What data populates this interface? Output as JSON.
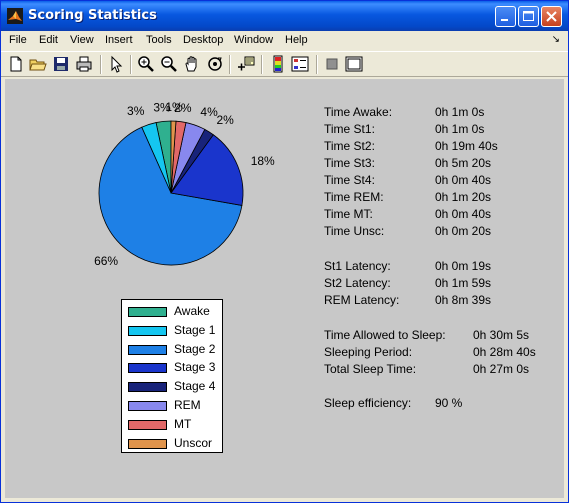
{
  "window": {
    "title": "Scoring Statistics"
  },
  "menu": [
    "File",
    "Edit",
    "View",
    "Insert",
    "Tools",
    "Desktop",
    "Window",
    "Help"
  ],
  "menu_arrow": "↘",
  "toolbar": {
    "icons": [
      "new-file-icon",
      "open-folder-icon",
      "save-icon",
      "print-icon",
      "pointer-arrow-icon",
      "zoom-in-icon",
      "zoom-out-icon",
      "pan-hand-icon",
      "rotate-3d-icon",
      "data-cursor-icon",
      "colorbar-icon",
      "legend-icon",
      "hide-plot-tools-icon",
      "show-plot-tools-icon"
    ]
  },
  "chart_data": {
    "type": "pie",
    "slices": [
      {
        "name": "Awake",
        "value": 1.0,
        "label": "3%",
        "color": "#2fb08f"
      },
      {
        "name": "Stage 1",
        "value": 1.0,
        "label": "3%",
        "color": "#15c6f0"
      },
      {
        "name": "Stage 2",
        "value": 19.67,
        "label": "66%",
        "color": "#1e80e6"
      },
      {
        "name": "Stage 3",
        "value": 5.33,
        "label": "18%",
        "color": "#1a35cc"
      },
      {
        "name": "Stage 4",
        "value": 0.67,
        "label": "2%",
        "color": "#18237a"
      },
      {
        "name": "REM",
        "value": 1.33,
        "label": "4%",
        "color": "#8888ee"
      },
      {
        "name": "MT",
        "value": 0.67,
        "label": "2%",
        "color": "#e26868"
      },
      {
        "name": "Unscor",
        "value": 0.33,
        "label": "1%",
        "color": "#e0944c"
      }
    ],
    "legend": [
      "Awake",
      "Stage 1",
      "Stage 2",
      "Stage 3",
      "Stage 4",
      "REM",
      "MT",
      "Unscor"
    ],
    "legend_placement": "below pie"
  },
  "stats": {
    "stage_times": [
      {
        "label": "Time Awake:",
        "value": "0h 1m 0s"
      },
      {
        "label": "Time St1:",
        "value": "0h 1m 0s"
      },
      {
        "label": "Time St2:",
        "value": "0h 19m 40s"
      },
      {
        "label": "Time St3:",
        "value": "0h 5m 20s"
      },
      {
        "label": "Time St4:",
        "value": "0h 0m 40s"
      },
      {
        "label": "Time REM:",
        "value": "0h 1m 20s"
      },
      {
        "label": "Time MT:",
        "value": "0h 0m 40s"
      },
      {
        "label": "Time Unsc:",
        "value": "0h 0m 20s"
      }
    ],
    "latencies": [
      {
        "label": "St1 Latency:",
        "value": "0h 0m 19s"
      },
      {
        "label": "St2 Latency:",
        "value": "0h 1m 59s"
      },
      {
        "label": "REM Latency:",
        "value": "0h 8m 39s"
      }
    ],
    "sleep": [
      {
        "label": "Time Allowed to Sleep:",
        "value": "0h 30m 5s"
      },
      {
        "label": "Sleeping Period:",
        "value": "0h 28m 40s"
      },
      {
        "label": "Total Sleep Time:",
        "value": "0h 27m 0s"
      }
    ],
    "efficiency": {
      "label": "Sleep efficiency:",
      "value": "90 %"
    }
  }
}
